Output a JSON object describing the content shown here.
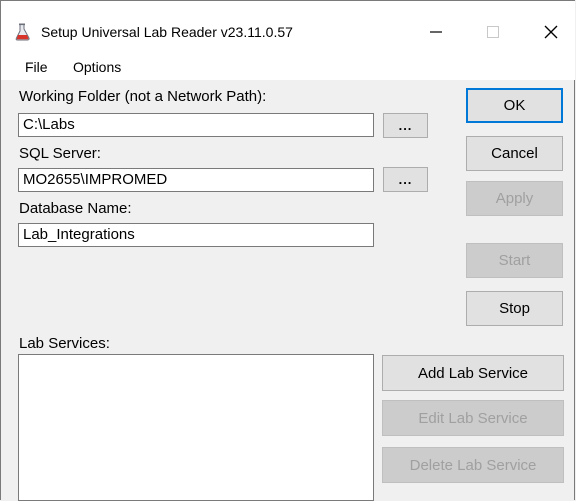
{
  "window": {
    "title": "Setup Universal Lab Reader v23.11.0.57",
    "icon": "flask-icon",
    "controls": {
      "minimize": "—",
      "maximize": "☐",
      "close": "✕"
    }
  },
  "menu": {
    "file": "File",
    "options": "Options"
  },
  "form": {
    "working_folder_label": "Working Folder (not a Network Path):",
    "working_folder_value": "C:\\Labs",
    "sql_server_label": "SQL Server:",
    "sql_server_value": "MO2655\\IMPROMED",
    "database_name_label": "Database Name:",
    "database_name_value": "Lab_Integrations",
    "browse_label": "...",
    "lab_services_label": "Lab Services:"
  },
  "buttons": {
    "ok": "OK",
    "cancel": "Cancel",
    "apply": "Apply",
    "start": "Start",
    "stop": "Stop",
    "add_lab_service": "Add Lab Service",
    "edit_lab_service": "Edit Lab Service",
    "delete_lab_service": "Delete Lab Service"
  }
}
